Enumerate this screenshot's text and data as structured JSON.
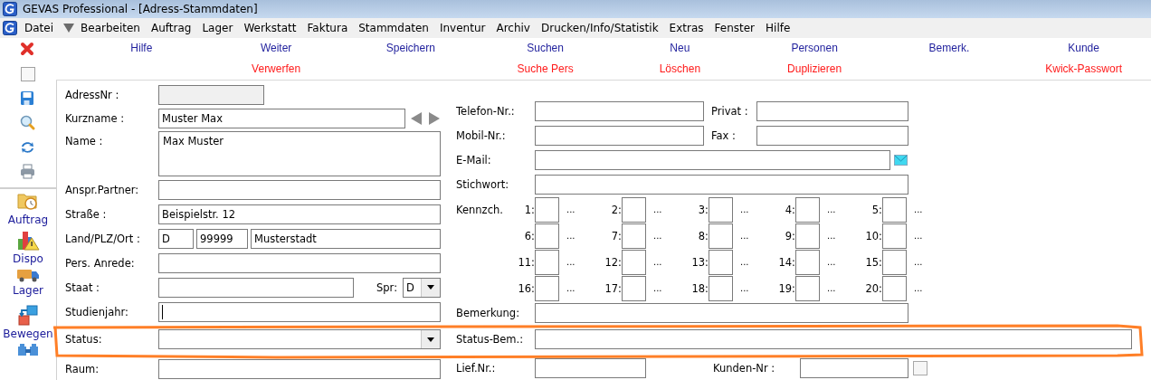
{
  "window": {
    "title": "GEVAS Professional - [Adress-Stammdaten]"
  },
  "menu": [
    {
      "label": "Datei"
    },
    {
      "kind": "dropdown"
    },
    {
      "label": "Bearbeiten"
    },
    {
      "label": "Auftrag"
    },
    {
      "label": "Lager"
    },
    {
      "label": "Werkstatt"
    },
    {
      "label": "Faktura"
    },
    {
      "label": "Stammdaten"
    },
    {
      "label": "Inventur"
    },
    {
      "label": "Archiv"
    },
    {
      "label": "Drucken/Info/Statistik"
    },
    {
      "label": "Extras"
    },
    {
      "label": "Fenster"
    },
    {
      "label": "Hilfe"
    }
  ],
  "toolbar": [
    {
      "top": "Hilfe"
    },
    {
      "top": "Weiter",
      "bottom": "Verwerfen"
    },
    {
      "top": "Speichern"
    },
    {
      "top": "Suchen",
      "bottom": "Suche Pers"
    },
    {
      "top": "Neu",
      "bottom": "Löschen"
    },
    {
      "top": "Personen",
      "bottom": "Duplizieren"
    },
    {
      "top": "Bemerk."
    },
    {
      "top": "Kunde",
      "bottom": "Kwick-Passwort"
    }
  ],
  "sidebar": {
    "tools": [
      {
        "kind": "close"
      },
      {
        "kind": "blank"
      },
      {
        "kind": "save"
      },
      {
        "kind": "search"
      },
      {
        "kind": "refresh"
      },
      {
        "kind": "print"
      }
    ],
    "modules": [
      {
        "label": "Auftrag",
        "kind": "folder"
      },
      {
        "label": "Dispo",
        "kind": "chart"
      },
      {
        "label": "Lager",
        "kind": "truck"
      },
      {
        "label": "Bewegen",
        "kind": "move"
      },
      {
        "kind": "group"
      }
    ]
  },
  "left_fields": [
    {
      "label": "AdressNr :",
      "kind": "readonly"
    },
    {
      "label": "Kurzname :",
      "kind": "text_nav",
      "value": "Muster Max"
    },
    {
      "label": "Name :",
      "kind": "multiline",
      "value": "Max Muster"
    },
    {
      "label": "Anspr.Partner:",
      "kind": "text"
    },
    {
      "label": "Straße :",
      "kind": "text",
      "value": "Beispielstr. 12"
    },
    {
      "label": "Land/PLZ/Ort :",
      "kind": "split",
      "values": [
        "D",
        "99999",
        "Musterstadt"
      ]
    },
    {
      "label": "Pers. Anrede:",
      "kind": "text"
    },
    {
      "label": "Staat :",
      "kind": "text_lang",
      "lang_label": "Spr:",
      "lang_value": "D"
    },
    {
      "label": "Studienjahr:",
      "kind": "text",
      "focused": true
    },
    {
      "label": "Status:",
      "kind": "combo"
    },
    {
      "label": "Raum:",
      "kind": "text"
    }
  ],
  "right_fields": [
    {
      "label": "Telefon-Nr.:",
      "kind": "pair",
      "second_label": "Privat :"
    },
    {
      "label": "Mobil-Nr.:",
      "kind": "pair",
      "second_label": "Fax :"
    },
    {
      "label": "E-Mail:",
      "kind": "email"
    },
    {
      "label": "Stichwort:",
      "kind": "text"
    },
    {
      "label": "Kennzch.",
      "kind": "flags",
      "flags": [
        {
          "number": "1:",
          "more": "..."
        },
        {
          "number": "2:",
          "more": "..."
        },
        {
          "number": "3:",
          "more": "..."
        },
        {
          "number": "4:",
          "more": "..."
        },
        {
          "number": "5:",
          "more": "..."
        },
        {
          "number": "6:",
          "more": "..."
        },
        {
          "number": "7:",
          "more": "..."
        },
        {
          "number": "8:",
          "more": "..."
        },
        {
          "number": "9:",
          "more": "..."
        },
        {
          "number": "10:",
          "more": "..."
        },
        {
          "number": "11:",
          "more": "..."
        },
        {
          "number": "12:",
          "more": "..."
        },
        {
          "number": "13:",
          "more": "..."
        },
        {
          "number": "14:",
          "more": "..."
        },
        {
          "number": "15:",
          "more": "..."
        },
        {
          "number": "16:",
          "more": "..."
        },
        {
          "number": "17:",
          "more": "..."
        },
        {
          "number": "18:",
          "more": "..."
        },
        {
          "number": "19:",
          "more": "..."
        },
        {
          "number": "20:",
          "more": "..."
        }
      ]
    },
    {
      "label": "Bemerkung:",
      "kind": "text"
    },
    {
      "label": "Status-Bem.:",
      "kind": "wide"
    },
    {
      "label": "Lief.Nr.:",
      "kind": "pair_check",
      "second_label": "Kunden-Nr :",
      "checked": false
    }
  ],
  "annotation": {
    "kind": "outline"
  }
}
